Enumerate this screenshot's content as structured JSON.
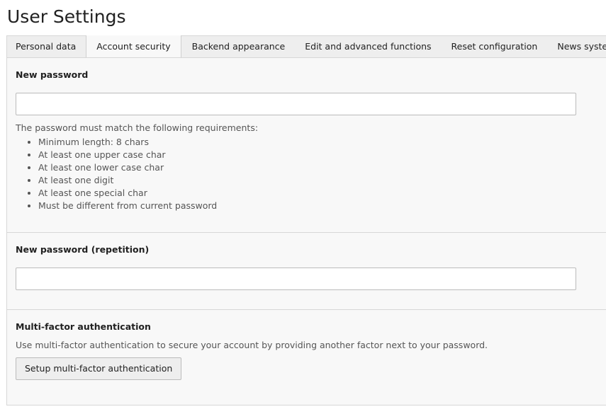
{
  "page": {
    "title": "User Settings"
  },
  "tabs": [
    {
      "label": "Personal data",
      "active": false
    },
    {
      "label": "Account security",
      "active": true
    },
    {
      "label": "Backend appearance",
      "active": false
    },
    {
      "label": "Edit and advanced functions",
      "active": false
    },
    {
      "label": "Reset configuration",
      "active": false
    },
    {
      "label": "News system",
      "active": false
    }
  ],
  "new_password": {
    "label": "New password",
    "value": "",
    "requirements_intro": "The password must match the following requirements:",
    "requirements": [
      "Minimum length: 8 chars",
      "At least one upper case char",
      "At least one lower case char",
      "At least one digit",
      "At least one special char",
      "Must be different from current password"
    ]
  },
  "password_repeat": {
    "label": "New password (repetition)",
    "value": ""
  },
  "mfa": {
    "label": "Multi-factor authentication",
    "description": "Use multi-factor authentication to secure your account by providing another factor next to your password.",
    "button_label": "Setup multi-factor authentication"
  }
}
